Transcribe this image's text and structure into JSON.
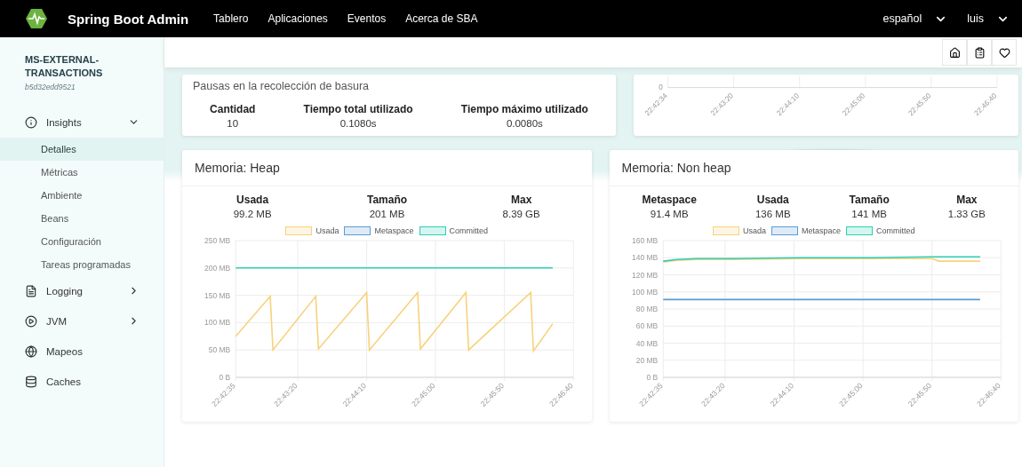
{
  "navbar": {
    "brand": "Spring Boot Admin",
    "links": [
      "Tablero",
      "Aplicaciones",
      "Eventos",
      "Acerca de SBA"
    ],
    "language": "español",
    "user": "luis"
  },
  "sidebar": {
    "app_name": "MS-EXTERNAL-TRANSACTIONS",
    "instance_id": "b5d32edd9521",
    "items": [
      {
        "label": "Insights",
        "expanded": true,
        "children": [
          {
            "label": "Detalles",
            "selected": true
          },
          {
            "label": "Métricas",
            "selected": false
          },
          {
            "label": "Ambiente",
            "selected": false
          },
          {
            "label": "Beans",
            "selected": false
          },
          {
            "label": "Configuración",
            "selected": false
          },
          {
            "label": "Tareas programadas",
            "selected": false
          }
        ]
      },
      {
        "label": "Logging",
        "expanded": false
      },
      {
        "label": "JVM",
        "expanded": false
      },
      {
        "label": "Mapeos"
      },
      {
        "label": "Caches"
      }
    ]
  },
  "gc_card": {
    "title": "Pausas en la recolección de basura",
    "stats": [
      {
        "label": "Cantidad",
        "value": "10"
      },
      {
        "label": "Tiempo total utilizado",
        "value": "0.1080s"
      },
      {
        "label": "Tiempo máximo utilizado",
        "value": "0.0080s"
      }
    ]
  },
  "throughput_card": {
    "y_tick": "0",
    "x_labels": [
      "22:42:34",
      "22:43:20",
      "22:44:10",
      "22:45:00",
      "22:45:50",
      "22:46:40"
    ]
  },
  "memory_panels": [
    {
      "title": "Memoria: Heap",
      "stats": [
        {
          "label": "Usada",
          "value": "99.2 MB"
        },
        {
          "label": "Tamaño",
          "value": "201 MB"
        },
        {
          "label": "Max",
          "value": "8.39 GB"
        }
      ],
      "chart_data": {
        "type": "line",
        "grid": true,
        "x": [
          81755,
          81780,
          81782,
          81813,
          81815,
          81850,
          81852,
          81887,
          81889,
          81922,
          81924,
          81969,
          81971,
          81985
        ],
        "xlim": [
          81755,
          82000
        ],
        "ylim": [
          0,
          250
        ],
        "xticks": [
          {
            "value": 81755,
            "label": "22:42:35"
          },
          {
            "value": 81800,
            "label": "22:43:20"
          },
          {
            "value": 81850,
            "label": "22:44:10"
          },
          {
            "value": 81900,
            "label": "22:45:00"
          },
          {
            "value": 81950,
            "label": "22:45:50"
          },
          {
            "value": 82000,
            "label": "22:46:40"
          }
        ],
        "yticks": [
          {
            "value": 0,
            "label": "0 B"
          },
          {
            "value": 50,
            "label": "50 MB"
          },
          {
            "value": 100,
            "label": "100 MB"
          },
          {
            "value": 150,
            "label": "150 MB"
          },
          {
            "value": 200,
            "label": "200 MB"
          },
          {
            "value": 250,
            "label": "250 MB"
          }
        ],
        "series": [
          {
            "name": "Usada",
            "color": "#f7d27a",
            "values": [
              75,
              148,
              50,
              148,
              52,
              155,
              50,
              155,
              52,
              155,
              50,
              155,
              48,
              98
            ]
          },
          {
            "name": "Metaspace",
            "color": "#5b9bd5",
            "values": [
              null,
              null,
              null,
              null,
              null,
              null,
              null,
              null,
              null,
              null,
              null,
              null,
              null,
              null
            ]
          },
          {
            "name": "Committed",
            "color": "#2ecfb4",
            "values": [
              200,
              200,
              200,
              200,
              200,
              200,
              200,
              200,
              200,
              200,
              200,
              200,
              200,
              200
            ]
          }
        ]
      }
    },
    {
      "title": "Memoria: Non heap",
      "stats": [
        {
          "label": "Metaspace",
          "value": "91.4 MB"
        },
        {
          "label": "Usada",
          "value": "136 MB"
        },
        {
          "label": "Tamaño",
          "value": "141 MB"
        },
        {
          "label": "Max",
          "value": "1.33 GB"
        }
      ],
      "chart_data": {
        "type": "line",
        "grid": true,
        "x": [
          81755,
          81765,
          81780,
          81805,
          81855,
          81905,
          81950,
          81955,
          81985
        ],
        "xlim": [
          81755,
          82000
        ],
        "ylim": [
          0,
          160
        ],
        "xticks": [
          {
            "value": 81755,
            "label": "22:42:35"
          },
          {
            "value": 81800,
            "label": "22:43:20"
          },
          {
            "value": 81850,
            "label": "22:44:10"
          },
          {
            "value": 81900,
            "label": "22:45:00"
          },
          {
            "value": 81950,
            "label": "22:45:50"
          },
          {
            "value": 82000,
            "label": "22:46:40"
          }
        ],
        "yticks": [
          {
            "value": 0,
            "label": "0 B"
          },
          {
            "value": 20,
            "label": "20 MB"
          },
          {
            "value": 40,
            "label": "40 MB"
          },
          {
            "value": 60,
            "label": "60 MB"
          },
          {
            "value": 80,
            "label": "80 MB"
          },
          {
            "value": 100,
            "label": "100 MB"
          },
          {
            "value": 120,
            "label": "120 MB"
          },
          {
            "value": 140,
            "label": "140 MB"
          },
          {
            "value": 160,
            "label": "160 MB"
          }
        ],
        "series": [
          {
            "name": "Usada",
            "color": "#f7d27a",
            "values": [
              135,
              137,
              138,
              138,
              139,
              139,
              139,
              136,
              136
            ]
          },
          {
            "name": "Metaspace",
            "color": "#5b9bd5",
            "values": [
              91,
              91,
              91,
              91,
              91,
              91,
              91,
              91,
              91
            ]
          },
          {
            "name": "Committed",
            "color": "#2ecfb4",
            "values": [
              136,
              138,
              139,
              139,
              140,
              140,
              141,
              141,
              141
            ]
          }
        ]
      }
    }
  ]
}
